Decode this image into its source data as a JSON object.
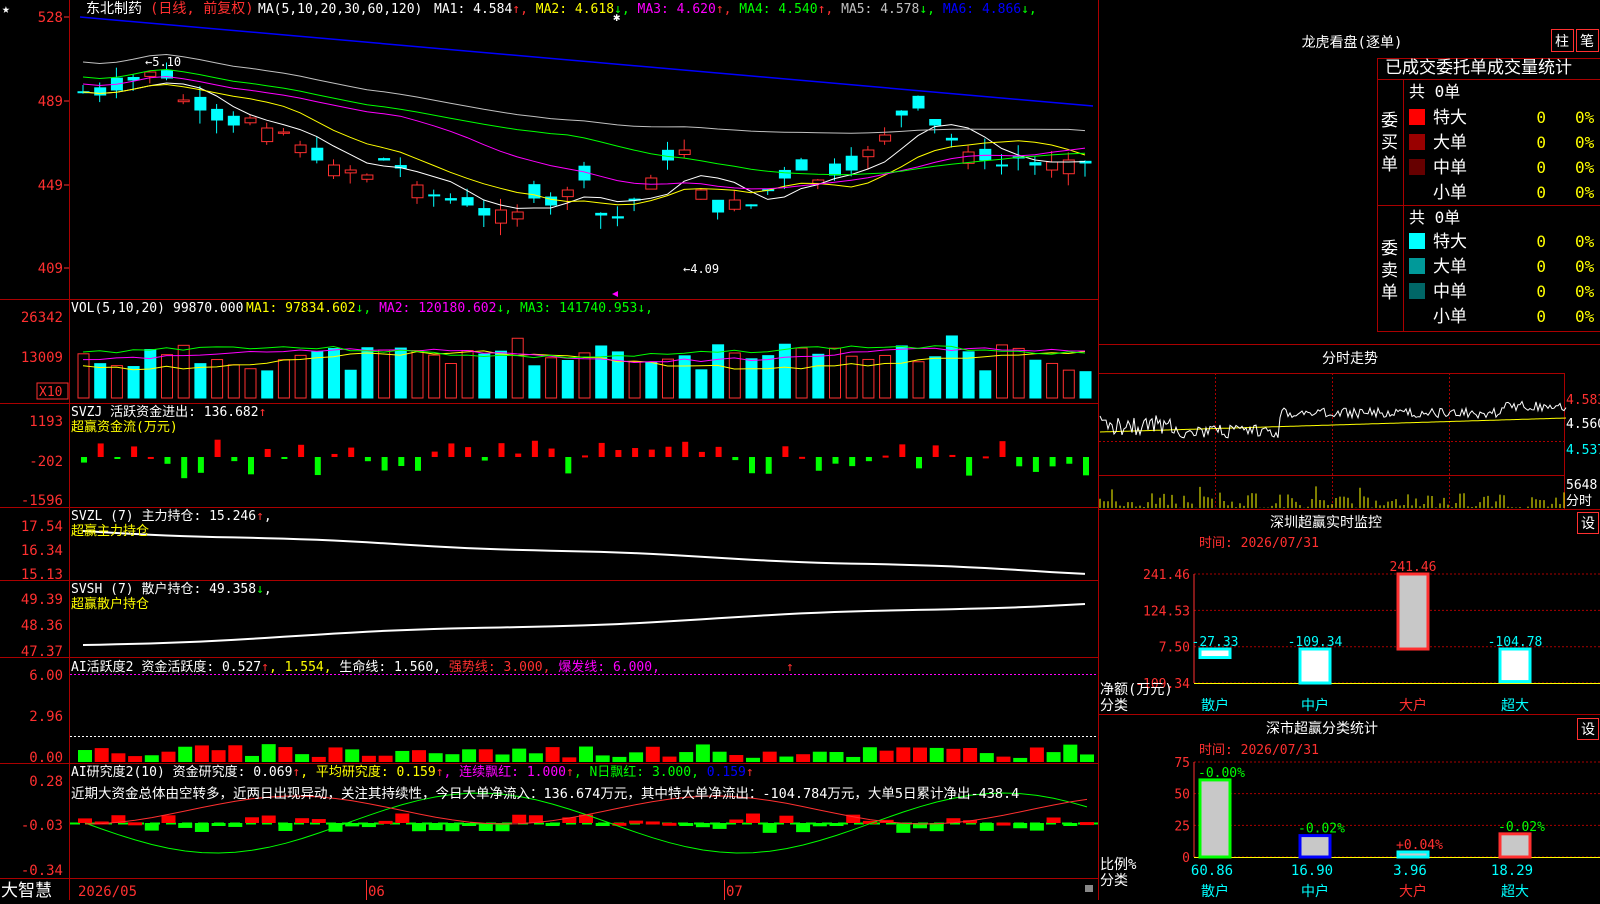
{
  "stock": {
    "name": "东北制药",
    "mode": "(日线, 前复权)",
    "star": "★"
  },
  "price_panel": {
    "ma_label": "MA(5,10,20,30,60,120)",
    "ma_values": [
      {
        "label": "MA1: 4.584",
        "arrow": "↑",
        "color": "#ffffff"
      },
      {
        "label": "MA2: 4.618",
        "arrow": "↓",
        "color": "#ffff00"
      },
      {
        "label": "MA3: 4.620",
        "arrow": "↑",
        "color": "#ff00ff"
      },
      {
        "label": "MA4: 4.540",
        "arrow": "↑",
        "color": "#00ff00"
      },
      {
        "label": "MA5: 4.578",
        "arrow": "↓",
        "color": "#c0c0c0"
      },
      {
        "label": "MA6: 4.866",
        "arrow": "↓",
        "color": "#0000ff"
      }
    ],
    "y_ticks": [
      "528",
      "489",
      "449",
      "409"
    ],
    "high_note": "5.10",
    "low_note": "4.09"
  },
  "vol_panel": {
    "label": "VOL(5,10,20)",
    "value": "99870.000",
    "ma": [
      {
        "label": "MA1: 97834.602",
        "arrow": "↓",
        "color": "#ffff00"
      },
      {
        "label": "MA2: 120180.602",
        "arrow": "↓",
        "color": "#ff00ff"
      },
      {
        "label": "MA3: 141740.953",
        "arrow": "↓",
        "color": "#00ff00"
      }
    ],
    "y_ticks": [
      "26342",
      "13009"
    ],
    "unit": "X10"
  },
  "svzj_panel": {
    "label": "SVZJ",
    "title": "活跃资金进出: 136.682",
    "arrow": "↑",
    "subtitle": "超赢资金流(万元)",
    "y_ticks": [
      "1193",
      "-202",
      "-1596"
    ]
  },
  "svzl_panel": {
    "label": "SVZL (7)",
    "title": "主力持仓: 15.246",
    "arrow": "↑",
    "subtitle": "超赢主力持仓",
    "y_ticks": [
      "17.54",
      "16.34",
      "15.13"
    ]
  },
  "svsh_panel": {
    "label": "SVSH (7)",
    "title": "散户持仓: 49.358",
    "arrow": "↓",
    "subtitle": "超赢散户持仓",
    "y_ticks": [
      "49.39",
      "48.36",
      "47.37"
    ]
  },
  "ai_active": {
    "label": "AI活跃度2",
    "parts": [
      {
        "text": "资金活跃度: 0.527",
        "color": "#ffffff"
      },
      {
        "text": "↑",
        "color": "#ff3030"
      },
      {
        "text": ", 1.554,",
        "color": "#ffff00"
      },
      {
        "text": " 生命线: 1.560,",
        "color": "#ffffff"
      },
      {
        "text": " 强势线: 3.000,",
        "color": "#ff3030"
      },
      {
        "text": " 爆发线: 6.000,",
        "color": "#ff00ff"
      }
    ],
    "y_ticks": [
      "6.00",
      "2.96",
      "0.00"
    ]
  },
  "ai_research": {
    "label": "AI研究度2(10)",
    "parts": [
      {
        "text": "资金研究度: 0.069",
        "color": "#ffffff"
      },
      {
        "text": "↑",
        "color": "#ff3030"
      },
      {
        "text": ", 平均研究度: 0.159",
        "color": "#ffff00"
      },
      {
        "text": "↑",
        "color": "#ff3030"
      },
      {
        "text": ", 连续飘红: 1.000",
        "color": "#ff00ff"
      },
      {
        "text": "↑",
        "color": "#ff3030"
      },
      {
        "text": ", N日飘红: 3.000,",
        "color": "#00ff00"
      },
      {
        "text": " 0.159",
        "color": "#0000ff"
      },
      {
        "text": "↑",
        "color": "#ff3030"
      }
    ],
    "comment": "近期大资金总体由空转多，近两日出现异动，关注其持续性，今日大单净流入：136.674万元，其中特大单净流出：-104.784万元，大单5日累计净出-438.4",
    "y_ticks": [
      "0.28",
      "-0.03",
      "-0.34"
    ]
  },
  "x_axis": {
    "labels": [
      "2026/05",
      "06",
      "07"
    ],
    "logo": "大智慧"
  },
  "right_panel": {
    "lhb_title": "龙虎看盘(逐单)",
    "btn_zhu": "柱",
    "btn_bi": "笔",
    "tabs": "已成交委托单成交量统计",
    "buy_side": "委买单",
    "sell_side": "委卖单",
    "buy_total": "共 0单",
    "sell_total": "共 0单",
    "buy_rows": [
      {
        "label": "特大",
        "count": "0",
        "pct": "0%",
        "color": "#ff0000"
      },
      {
        "label": "大单",
        "count": "0",
        "pct": "0%",
        "color": "#990000"
      },
      {
        "label": "中单",
        "count": "0",
        "pct": "0%",
        "color": "#660000"
      },
      {
        "label": "小单",
        "count": "0",
        "pct": "0%",
        "color": "#000000"
      }
    ],
    "sell_rows": [
      {
        "label": "特大",
        "count": "0",
        "pct": "0%",
        "color": "#00ffff"
      },
      {
        "label": "大单",
        "count": "0",
        "pct": "0%",
        "color": "#009999"
      },
      {
        "label": "中单",
        "count": "0",
        "pct": "0%",
        "color": "#006666"
      },
      {
        "label": "小单",
        "count": "0",
        "pct": "0%",
        "color": "#000000"
      }
    ],
    "fenshi_title": "分时走势",
    "fenshi_ticks": [
      "4.583",
      "4.560",
      "4.537"
    ],
    "fenshi_vol": "5648",
    "fenshi_unit": "分时",
    "monitor_title": "深圳超赢实时监控",
    "monitor_time": "时间: 2026/07/31",
    "monitor_set": "设",
    "monitor_ticks": [
      "241.46",
      "124.53",
      "7.50",
      "-109.34"
    ],
    "monitor_caption1": "净额(万元)",
    "monitor_caption2": "分类",
    "stat_title": "深市超赢分类统计",
    "stat_time": "时间: 2026/07/31",
    "stat_set": "设",
    "stat_ticks": [
      "75",
      "50",
      "25",
      "0"
    ],
    "stat_caption1": "比例%",
    "stat_caption2": "分类"
  },
  "chart_data": [
    {
      "type": "bar",
      "title": "深圳超赢实时监控",
      "categories": [
        "散户",
        "中户",
        "大户",
        "超大"
      ],
      "values": [
        -27.33,
        -109.34,
        241.46,
        -104.78
      ],
      "labels": [
        "-27.33",
        "-109.34",
        "241.46",
        "-104.78"
      ],
      "ylabel": "净额(万元)",
      "ylim": [
        -109.34,
        241.46
      ]
    },
    {
      "type": "bar",
      "title": "深市超赢分类统计",
      "categories": [
        "散户",
        "中户",
        "大户",
        "超大"
      ],
      "values": [
        60.86,
        16.9,
        3.96,
        18.29
      ],
      "value_labels": [
        "60.86",
        "16.90",
        "3.96",
        "18.29"
      ],
      "change_labels": [
        "-0.00%",
        "-0.02%",
        "+0.04%",
        "-0.02%"
      ],
      "ylabel": "比例%",
      "ylim": [
        0,
        75
      ]
    },
    {
      "type": "line",
      "title": "日线",
      "series": [
        {
          "name": "MA6",
          "values": [
            5.28,
            4.86
          ]
        }
      ],
      "annotations": [
        "5.10",
        "4.09"
      ]
    }
  ]
}
